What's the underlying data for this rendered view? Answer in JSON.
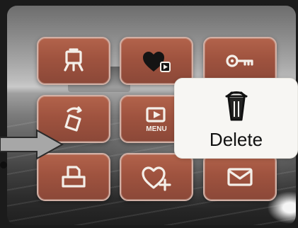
{
  "menu": {
    "items": [
      {
        "id": "slideshow",
        "icon": "slideshow-icon"
      },
      {
        "id": "favorites-play",
        "icon": "heart-play-icon"
      },
      {
        "id": "protect",
        "icon": "key-icon"
      },
      {
        "id": "rotate",
        "icon": "rotate-icon"
      },
      {
        "id": "menu",
        "icon": "play-menu-icon"
      },
      {
        "id": "print",
        "icon": "print-icon"
      },
      {
        "id": "add-favorite",
        "icon": "heart-add-icon"
      },
      {
        "id": "email",
        "icon": "envelope-icon"
      }
    ],
    "highlighted": {
      "label": "Delete",
      "icon": "trash-icon"
    },
    "menu_badge": "MENU"
  },
  "colors": {
    "tile_fill": "#9f533f",
    "tile_border": "#d2b0a5",
    "callout_bg": "#f7f6f3",
    "screen_dark": "#1b1b1b"
  }
}
